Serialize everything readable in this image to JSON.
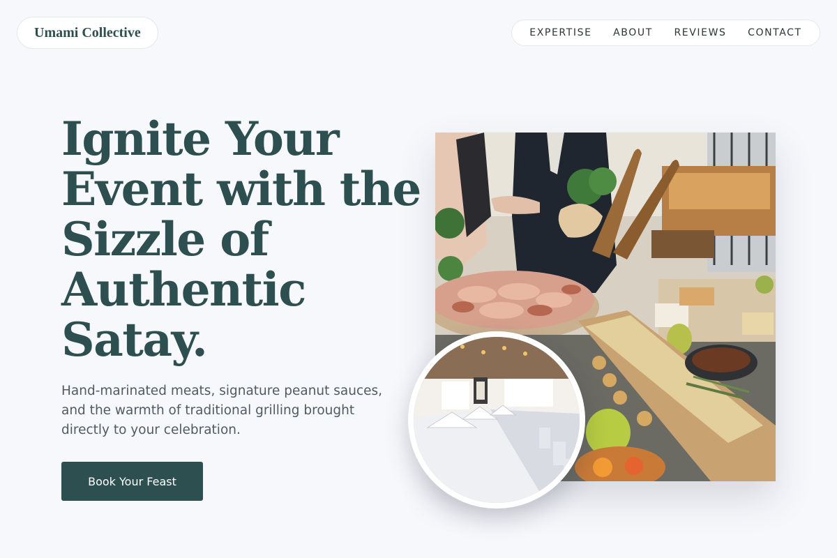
{
  "header": {
    "brand": "Umami Collective",
    "nav": [
      {
        "label": "EXPERTISE"
      },
      {
        "label": "ABOUT"
      },
      {
        "label": "REVIEWS"
      },
      {
        "label": "CONTACT"
      }
    ]
  },
  "hero": {
    "headline_lines": [
      "Ignite Your",
      "Event with the",
      "Sizzle of",
      "Authentic",
      "Satay."
    ],
    "subtext_lines": [
      "Hand-marinated meats, signature peanut sauces,",
      "and the warmth of traditional grilling brought",
      "directly to your celebration."
    ],
    "cta_label": "Book Your Feast"
  },
  "colors": {
    "background": "#f7f8fc",
    "brand_green": "#2e4f4f",
    "body_text": "#505a62",
    "nav_text": "#2d3436"
  }
}
